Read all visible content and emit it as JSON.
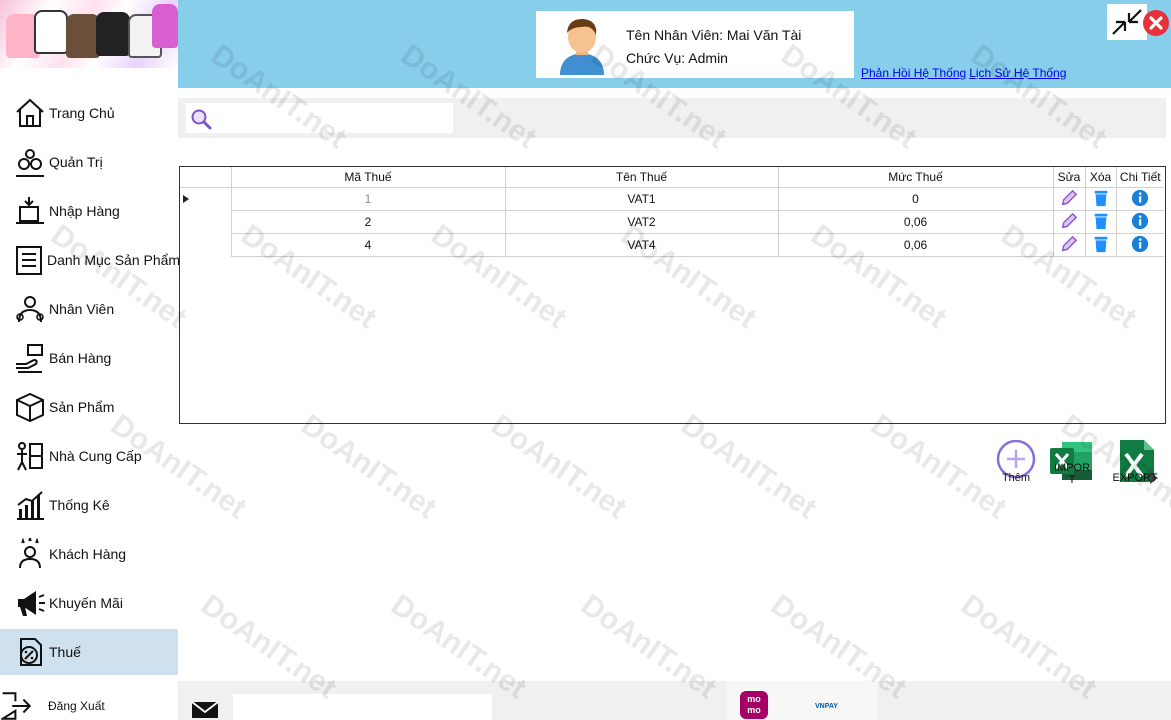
{
  "sidebar": {
    "items": [
      {
        "label": "Trang Chủ",
        "icon": "home-icon"
      },
      {
        "label": "Quản Trị",
        "icon": "admin-gears-icon"
      },
      {
        "label": "Nhập Hàng",
        "icon": "import-goods-icon"
      },
      {
        "label": "Danh Mục Sản Phẩm",
        "icon": "category-list-icon"
      },
      {
        "label": "Nhân Viên",
        "icon": "staff-icon"
      },
      {
        "label": "Bán Hàng",
        "icon": "sales-icon"
      },
      {
        "label": "Sản Phẩm",
        "icon": "box-icon"
      },
      {
        "label": "Nhà Cung Cấp",
        "icon": "supplier-icon"
      },
      {
        "label": "Thống Kê",
        "icon": "statistics-chart-icon"
      },
      {
        "label": "Khách Hàng",
        "icon": "customer-icon"
      },
      {
        "label": "Khuyến Mãi",
        "icon": "promotion-megaphone-icon"
      },
      {
        "label": "Thuế",
        "icon": "tax-document-icon",
        "active": true
      }
    ],
    "logout_label": "Đăng Xuất"
  },
  "header": {
    "employee_name": "Tên Nhân Viên: Mai Văn Tài",
    "role": "Chức Vụ: Admin",
    "link_feedback": "Phản Hồi Hệ Thống",
    "link_history": "Lịch Sử Hệ Thống"
  },
  "search": {
    "value": "",
    "placeholder": ""
  },
  "table": {
    "headers": {
      "code": "Mã Thuế",
      "name": "Tên Thuế",
      "rate": "Mức Thuế",
      "edit": "Sửa",
      "delete": "Xóa",
      "detail": "Chi Tiết"
    },
    "rows": [
      {
        "code": "1",
        "name": "VAT1",
        "rate": "0"
      },
      {
        "code": "2",
        "name": "VAT2",
        "rate": "0,06"
      },
      {
        "code": "4",
        "name": "VAT4",
        "rate": "0,06"
      }
    ]
  },
  "actions": {
    "add_label": "Thêm",
    "import_label": "IMPORT",
    "export_label": "EXPORT"
  },
  "footer": {
    "chat_value": "",
    "momo_label": "mo mo",
    "vnpay_label": "VNPAY"
  },
  "watermark": "DoAnIT.net",
  "colors": {
    "header_bg": "#87ceeb",
    "active_nav": "#cfe0ee",
    "close_red": "#e8303a",
    "excel_green": "#1d6f42",
    "info_blue": "#1a7fd8",
    "delete_blue": "#1e90ff",
    "edit_purple": "#8a4fcf"
  }
}
